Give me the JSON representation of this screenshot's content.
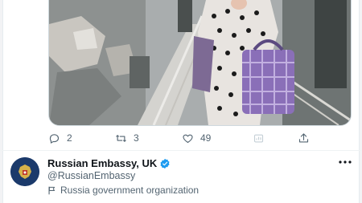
{
  "tweet": {
    "actions": {
      "reply_count": "2",
      "retweet_count": "3",
      "like_count": "49"
    }
  },
  "profile": {
    "name": "Russian Embassy, UK",
    "handle": "@RussianEmbassy",
    "label": "Russia government organization"
  },
  "colors": {
    "icon_gray": "#536471",
    "verified_blue": "#1d9bf0",
    "text": "#0f1419"
  },
  "icons": [
    "reply-icon",
    "retweet-icon",
    "like-icon",
    "analytics-icon",
    "share-icon",
    "verified-icon",
    "flag-icon",
    "more-icon"
  ]
}
